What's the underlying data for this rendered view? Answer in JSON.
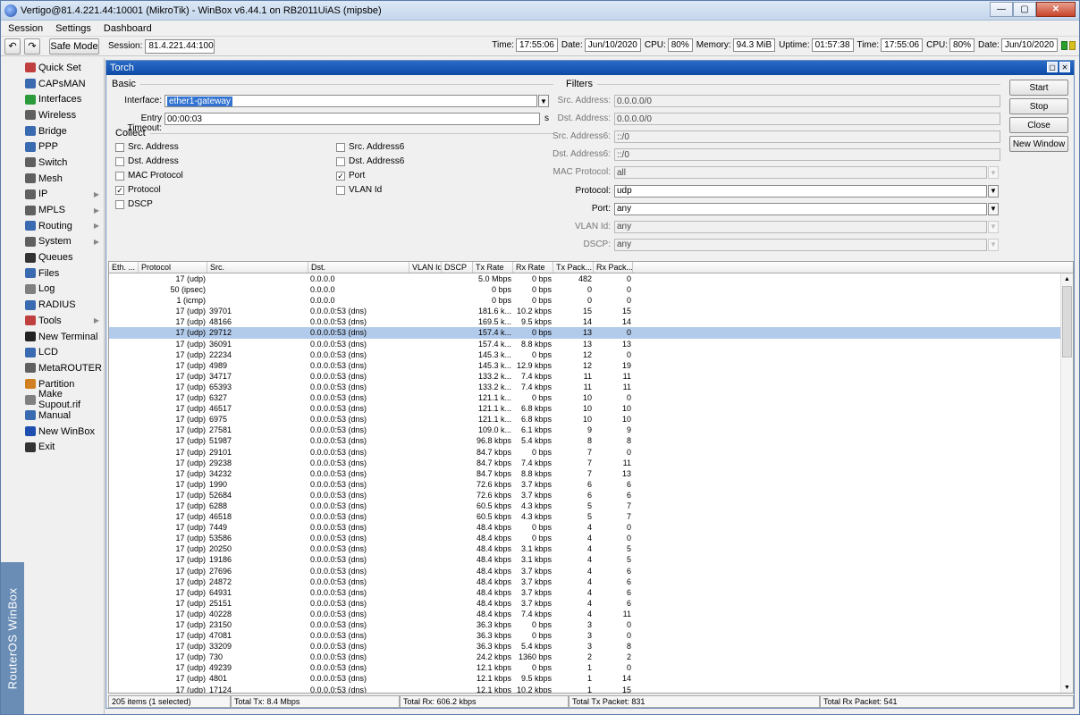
{
  "window": {
    "title": "Vertigo@81.4.221.44:10001 (MikroTik) - WinBox v6.44.1 on RB2011UiAS (mipsbe)"
  },
  "menu": [
    "Session",
    "Settings",
    "Dashboard"
  ],
  "toolbar": {
    "safe_mode": "Safe Mode",
    "session_label": "Session:",
    "session_value": "81.4.221.44:10001"
  },
  "status": {
    "time_label": "Time:",
    "time": "17:55:06",
    "date_label": "Date:",
    "date": "Jun/10/2020",
    "cpu_label": "CPU:",
    "cpu": "80%",
    "memory_label": "Memory:",
    "memory": "94.3 MiB",
    "uptime_label": "Uptime:",
    "uptime": "01:57:38"
  },
  "sidebar": {
    "brand": "RouterOS WinBox",
    "items": [
      {
        "label": "Quick Set",
        "icon": "quickset-icon",
        "color": "#c04040",
        "sub": false
      },
      {
        "label": "CAPsMAN",
        "icon": "capsman-icon",
        "color": "#3a6ab0",
        "sub": false
      },
      {
        "label": "Interfaces",
        "icon": "interfaces-icon",
        "color": "#2a9a3a",
        "sub": false
      },
      {
        "label": "Wireless",
        "icon": "wireless-icon",
        "color": "#606060",
        "sub": false
      },
      {
        "label": "Bridge",
        "icon": "bridge-icon",
        "color": "#3a6ab0",
        "sub": false
      },
      {
        "label": "PPP",
        "icon": "ppp-icon",
        "color": "#3a6ab0",
        "sub": false
      },
      {
        "label": "Switch",
        "icon": "switch-icon",
        "color": "#606060",
        "sub": false
      },
      {
        "label": "Mesh",
        "icon": "mesh-icon",
        "color": "#606060",
        "sub": false
      },
      {
        "label": "IP",
        "icon": "ip-icon",
        "color": "#606060",
        "sub": true
      },
      {
        "label": "MPLS",
        "icon": "mpls-icon",
        "color": "#606060",
        "sub": true
      },
      {
        "label": "Routing",
        "icon": "routing-icon",
        "color": "#3a6ab0",
        "sub": true
      },
      {
        "label": "System",
        "icon": "system-icon",
        "color": "#606060",
        "sub": true
      },
      {
        "label": "Queues",
        "icon": "queues-icon",
        "color": "#333333",
        "sub": false
      },
      {
        "label": "Files",
        "icon": "files-icon",
        "color": "#3a6ab0",
        "sub": false
      },
      {
        "label": "Log",
        "icon": "log-icon",
        "color": "#808080",
        "sub": false
      },
      {
        "label": "RADIUS",
        "icon": "radius-icon",
        "color": "#3a6ab0",
        "sub": false
      },
      {
        "label": "Tools",
        "icon": "tools-icon",
        "color": "#c04040",
        "sub": true
      },
      {
        "label": "New Terminal",
        "icon": "terminal-icon",
        "color": "#222222",
        "sub": false
      },
      {
        "label": "LCD",
        "icon": "lcd-icon",
        "color": "#3a6ab0",
        "sub": false
      },
      {
        "label": "MetaROUTER",
        "icon": "metarouter-icon",
        "color": "#606060",
        "sub": false
      },
      {
        "label": "Partition",
        "icon": "partition-icon",
        "color": "#d08020",
        "sub": false
      },
      {
        "label": "Make Supout.rif",
        "icon": "supout-icon",
        "color": "#808080",
        "sub": false
      },
      {
        "label": "Manual",
        "icon": "manual-icon",
        "color": "#3a6ab0",
        "sub": false
      },
      {
        "label": "New WinBox",
        "icon": "winbox-icon",
        "color": "#1e4fb0",
        "sub": false
      },
      {
        "label": "Exit",
        "icon": "exit-icon",
        "color": "#333333",
        "sub": false
      }
    ]
  },
  "torch": {
    "title": "Torch",
    "basic_label": "Basic",
    "interface_label": "Interface:",
    "interface_value": "ether1-gateway",
    "entry_timeout_label": "Entry Timeout:",
    "entry_timeout_value": "00:00:03",
    "entry_timeout_unit": "s",
    "collect_label": "Collect",
    "collect": [
      {
        "label": "Src. Address",
        "checked": false
      },
      {
        "label": "Dst. Address",
        "checked": false
      },
      {
        "label": "MAC Protocol",
        "checked": false
      },
      {
        "label": "Protocol",
        "checked": true
      },
      {
        "label": "DSCP",
        "checked": false
      },
      {
        "label": "Src. Address6",
        "checked": false
      },
      {
        "label": "Dst. Address6",
        "checked": false
      },
      {
        "label": "Port",
        "checked": true
      },
      {
        "label": "VLAN Id",
        "checked": false
      }
    ],
    "filters_label": "Filters",
    "filters": [
      {
        "label": "Src. Address:",
        "value": "0.0.0.0/0",
        "enabled": false,
        "dd": false
      },
      {
        "label": "Dst. Address:",
        "value": "0.0.0.0/0",
        "enabled": false,
        "dd": false
      },
      {
        "label": "Src. Address6:",
        "value": "::/0",
        "enabled": false,
        "dd": false
      },
      {
        "label": "Dst. Address6:",
        "value": "::/0",
        "enabled": false,
        "dd": false
      },
      {
        "label": "MAC Protocol:",
        "value": "all",
        "enabled": false,
        "dd": true
      },
      {
        "label": "Protocol:",
        "value": "udp",
        "enabled": true,
        "dd": true
      },
      {
        "label": "Port:",
        "value": "any",
        "enabled": true,
        "dd": true
      },
      {
        "label": "VLAN Id:",
        "value": "any",
        "enabled": false,
        "dd": true
      },
      {
        "label": "DSCP:",
        "value": "any",
        "enabled": false,
        "dd": true
      }
    ],
    "actions": [
      "Start",
      "Stop",
      "Close",
      "New Window"
    ],
    "columns": [
      "Eth. ...",
      "Protocol",
      "Src.",
      "Dst.",
      "VLAN Id",
      "DSCP",
      "Tx Rate",
      "Rx Rate",
      "Tx Pack...",
      "Rx Pack..."
    ],
    "rows": [
      [
        "",
        "17 (udp)",
        "",
        "0.0.0.0",
        "",
        "",
        "5.0 Mbps",
        "0 bps",
        "482",
        "0"
      ],
      [
        "",
        "50 (ipsec)",
        "",
        "0.0.0.0",
        "",
        "",
        "0 bps",
        "0 bps",
        "0",
        "0"
      ],
      [
        "",
        "1 (icmp)",
        "",
        "0.0.0.0",
        "",
        "",
        "0 bps",
        "0 bps",
        "0",
        "0"
      ],
      [
        "",
        "17 (udp)",
        "39701",
        "0.0.0.0:53 (dns)",
        "",
        "",
        "181.6 k...",
        "10.2 kbps",
        "15",
        "15"
      ],
      [
        "",
        "17 (udp)",
        "48166",
        "0.0.0.0:53 (dns)",
        "",
        "",
        "169.5 k...",
        "9.5 kbps",
        "14",
        "14"
      ],
      [
        "",
        "17 (udp)",
        "29712",
        "0.0.0.0:53 (dns)",
        "",
        "",
        "157.4 k...",
        "0 bps",
        "13",
        "0"
      ],
      [
        "",
        "17 (udp)",
        "36091",
        "0.0.0.0:53 (dns)",
        "",
        "",
        "157.4 k...",
        "8.8 kbps",
        "13",
        "13"
      ],
      [
        "",
        "17 (udp)",
        "22234",
        "0.0.0.0:53 (dns)",
        "",
        "",
        "145.3 k...",
        "0 bps",
        "12",
        "0"
      ],
      [
        "",
        "17 (udp)",
        "4989",
        "0.0.0.0:53 (dns)",
        "",
        "",
        "145.3 k...",
        "12.9 kbps",
        "12",
        "19"
      ],
      [
        "",
        "17 (udp)",
        "34717",
        "0.0.0.0:53 (dns)",
        "",
        "",
        "133.2 k...",
        "7.4 kbps",
        "11",
        "11"
      ],
      [
        "",
        "17 (udp)",
        "65393",
        "0.0.0.0:53 (dns)",
        "",
        "",
        "133.2 k...",
        "7.4 kbps",
        "11",
        "11"
      ],
      [
        "",
        "17 (udp)",
        "6327",
        "0.0.0.0:53 (dns)",
        "",
        "",
        "121.1 k...",
        "0 bps",
        "10",
        "0"
      ],
      [
        "",
        "17 (udp)",
        "46517",
        "0.0.0.0:53 (dns)",
        "",
        "",
        "121.1 k...",
        "6.8 kbps",
        "10",
        "10"
      ],
      [
        "",
        "17 (udp)",
        "6975",
        "0.0.0.0:53 (dns)",
        "",
        "",
        "121.1 k...",
        "6.8 kbps",
        "10",
        "10"
      ],
      [
        "",
        "17 (udp)",
        "27581",
        "0.0.0.0:53 (dns)",
        "",
        "",
        "109.0 k...",
        "6.1 kbps",
        "9",
        "9"
      ],
      [
        "",
        "17 (udp)",
        "51987",
        "0.0.0.0:53 (dns)",
        "",
        "",
        "96.8 kbps",
        "5.4 kbps",
        "8",
        "8"
      ],
      [
        "",
        "17 (udp)",
        "29101",
        "0.0.0.0:53 (dns)",
        "",
        "",
        "84.7 kbps",
        "0 bps",
        "7",
        "0"
      ],
      [
        "",
        "17 (udp)",
        "29238",
        "0.0.0.0:53 (dns)",
        "",
        "",
        "84.7 kbps",
        "7.4 kbps",
        "7",
        "11"
      ],
      [
        "",
        "17 (udp)",
        "34232",
        "0.0.0.0:53 (dns)",
        "",
        "",
        "84.7 kbps",
        "8.8 kbps",
        "7",
        "13"
      ],
      [
        "",
        "17 (udp)",
        "1990",
        "0.0.0.0:53 (dns)",
        "",
        "",
        "72.6 kbps",
        "3.7 kbps",
        "6",
        "6"
      ],
      [
        "",
        "17 (udp)",
        "52684",
        "0.0.0.0:53 (dns)",
        "",
        "",
        "72.6 kbps",
        "3.7 kbps",
        "6",
        "6"
      ],
      [
        "",
        "17 (udp)",
        "6288",
        "0.0.0.0:53 (dns)",
        "",
        "",
        "60.5 kbps",
        "4.3 kbps",
        "5",
        "7"
      ],
      [
        "",
        "17 (udp)",
        "46518",
        "0.0.0.0:53 (dns)",
        "",
        "",
        "60.5 kbps",
        "4.3 kbps",
        "5",
        "7"
      ],
      [
        "",
        "17 (udp)",
        "7449",
        "0.0.0.0:53 (dns)",
        "",
        "",
        "48.4 kbps",
        "0 bps",
        "4",
        "0"
      ],
      [
        "",
        "17 (udp)",
        "53586",
        "0.0.0.0:53 (dns)",
        "",
        "",
        "48.4 kbps",
        "0 bps",
        "4",
        "0"
      ],
      [
        "",
        "17 (udp)",
        "20250",
        "0.0.0.0:53 (dns)",
        "",
        "",
        "48.4 kbps",
        "3.1 kbps",
        "4",
        "5"
      ],
      [
        "",
        "17 (udp)",
        "19186",
        "0.0.0.0:53 (dns)",
        "",
        "",
        "48.4 kbps",
        "3.1 kbps",
        "4",
        "5"
      ],
      [
        "",
        "17 (udp)",
        "27696",
        "0.0.0.0:53 (dns)",
        "",
        "",
        "48.4 kbps",
        "3.7 kbps",
        "4",
        "6"
      ],
      [
        "",
        "17 (udp)",
        "24872",
        "0.0.0.0:53 (dns)",
        "",
        "",
        "48.4 kbps",
        "3.7 kbps",
        "4",
        "6"
      ],
      [
        "",
        "17 (udp)",
        "64931",
        "0.0.0.0:53 (dns)",
        "",
        "",
        "48.4 kbps",
        "3.7 kbps",
        "4",
        "6"
      ],
      [
        "",
        "17 (udp)",
        "25151",
        "0.0.0.0:53 (dns)",
        "",
        "",
        "48.4 kbps",
        "3.7 kbps",
        "4",
        "6"
      ],
      [
        "",
        "17 (udp)",
        "40228",
        "0.0.0.0:53 (dns)",
        "",
        "",
        "48.4 kbps",
        "7.4 kbps",
        "4",
        "11"
      ],
      [
        "",
        "17 (udp)",
        "23150",
        "0.0.0.0:53 (dns)",
        "",
        "",
        "36.3 kbps",
        "0 bps",
        "3",
        "0"
      ],
      [
        "",
        "17 (udp)",
        "47081",
        "0.0.0.0:53 (dns)",
        "",
        "",
        "36.3 kbps",
        "0 bps",
        "3",
        "0"
      ],
      [
        "",
        "17 (udp)",
        "33209",
        "0.0.0.0:53 (dns)",
        "",
        "",
        "36.3 kbps",
        "5.4 kbps",
        "3",
        "8"
      ],
      [
        "",
        "17 (udp)",
        "730",
        "0.0.0.0:53 (dns)",
        "",
        "",
        "24.2 kbps",
        "1360 bps",
        "2",
        "2"
      ],
      [
        "",
        "17 (udp)",
        "49239",
        "0.0.0.0:53 (dns)",
        "",
        "",
        "12.1 kbps",
        "0 bps",
        "1",
        "0"
      ],
      [
        "",
        "17 (udp)",
        "4801",
        "0.0.0.0:53 (dns)",
        "",
        "",
        "12.1 kbps",
        "9.5 kbps",
        "1",
        "14"
      ],
      [
        "",
        "17 (udp)",
        "17124",
        "0.0.0.0:53 (dns)",
        "",
        "",
        "12.1 kbps",
        "10.2 kbps",
        "1",
        "15"
      ]
    ],
    "selected_row": 5,
    "statusbar": [
      "205 items (1 selected)",
      "Total Tx: 8.4 Mbps",
      "Total Rx: 606.2 kbps",
      "Total Tx Packet: 831",
      "Total Rx Packet: 541"
    ]
  }
}
